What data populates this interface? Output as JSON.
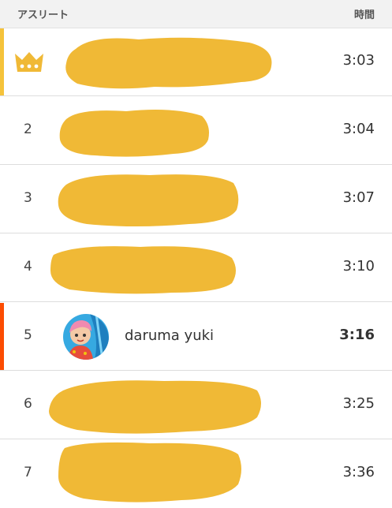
{
  "header": {
    "athlete_label": "アスリート",
    "time_label": "時間"
  },
  "colors": {
    "accent_first": "#f5c33b",
    "accent_current": "#fc4c02",
    "redaction": "#f0b936"
  },
  "rows": [
    {
      "rank": "",
      "rank_icon": "crown-icon",
      "athlete": "",
      "redacted": true,
      "time": "3:03",
      "highlight": "first"
    },
    {
      "rank": "2",
      "athlete": "",
      "redacted": true,
      "time": "3:04"
    },
    {
      "rank": "3",
      "athlete": "",
      "redacted": true,
      "time": "3:07"
    },
    {
      "rank": "4",
      "athlete": "",
      "redacted": true,
      "time": "3:10"
    },
    {
      "rank": "5",
      "athlete": "daruma yuki",
      "avatar_icon": "avatar-icon",
      "redacted": false,
      "time": "3:16",
      "highlight": "current"
    },
    {
      "rank": "6",
      "athlete": "",
      "redacted": true,
      "time": "3:25"
    },
    {
      "rank": "7",
      "athlete": "",
      "redacted": true,
      "time": "3:36"
    }
  ]
}
